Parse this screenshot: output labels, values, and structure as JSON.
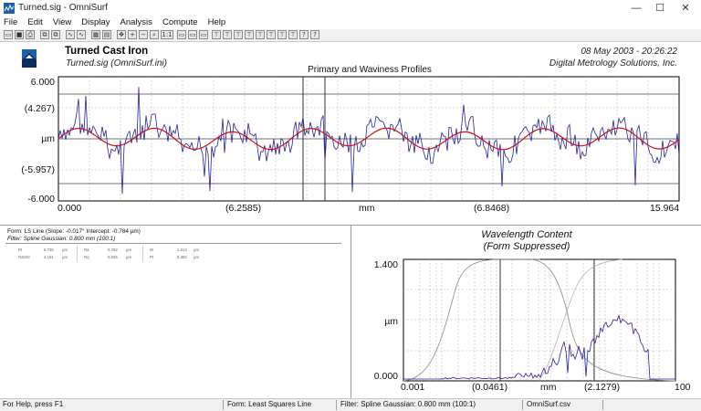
{
  "window": {
    "title": "Turned.sig - OmniSurf",
    "buttons": {
      "minimize": "—",
      "maximize": "☐",
      "close": "✕"
    }
  },
  "menu": [
    "File",
    "Edit",
    "View",
    "Display",
    "Analysis",
    "Compute",
    "Help"
  ],
  "toolbar": {
    "icons": [
      "open-icon",
      "save-icon",
      "print-icon",
      "zoom-in-icon",
      "zoom-out-icon",
      "zoom-icon",
      "one-to-one-icon",
      "profile-icon",
      "filter-icon",
      "help-icon"
    ],
    "one_to_one": "1:1",
    "help": "?",
    "context_help": "?"
  },
  "header": {
    "title": "Turned Cast Iron",
    "subtitle": "Turned.sig  (OmniSurf.ini)",
    "date": "08 May 2003 - 20:26:22",
    "company": "Digital Metrology Solutions, Inc."
  },
  "profile_chart": {
    "title": "Primary and Waviness Profiles",
    "y_labels": [
      "6.000",
      "(4.267)",
      "µm",
      "(-5.957)",
      "-6.000"
    ],
    "x_labels": [
      "0.000",
      "(6.2585)",
      "mm",
      "(6.8468)",
      "15.964"
    ],
    "colors": {
      "primary": "#22229a",
      "waviness": "#cc1111",
      "grid": "#b8b8b8"
    }
  },
  "info": {
    "form": "Form: LS Line   (Slope: -0.017°  Intercept: -0.784 µm)",
    "filter": "Filter: Spline Gaussian: 0.800 mm (100:1)",
    "params": [
      [
        "Rt",
        "6.736",
        "µm",
        "Ra",
        "0.782",
        "µm",
        "W",
        "1.614",
        "µm"
      ],
      [
        "RzDIN",
        "4.151",
        "µm",
        "Rq",
        "0.925",
        "µm",
        "Pt",
        "8.350",
        "µm"
      ]
    ]
  },
  "wavelength_chart": {
    "title": "Wavelength Content",
    "subtitle": "(Form Suppressed)",
    "y_labels": [
      "1.400",
      "µm",
      "0.000"
    ],
    "x_labels": [
      "0.001",
      "(0.0461)",
      "mm",
      "(2.1279)",
      "100"
    ]
  },
  "status": {
    "help": "For Help, press F1",
    "form": "Form: Least Squares Line",
    "filter": "Filter: Spline Gaussian: 0.800 mm (100:1)",
    "file": "OmniSurf.csv"
  }
}
